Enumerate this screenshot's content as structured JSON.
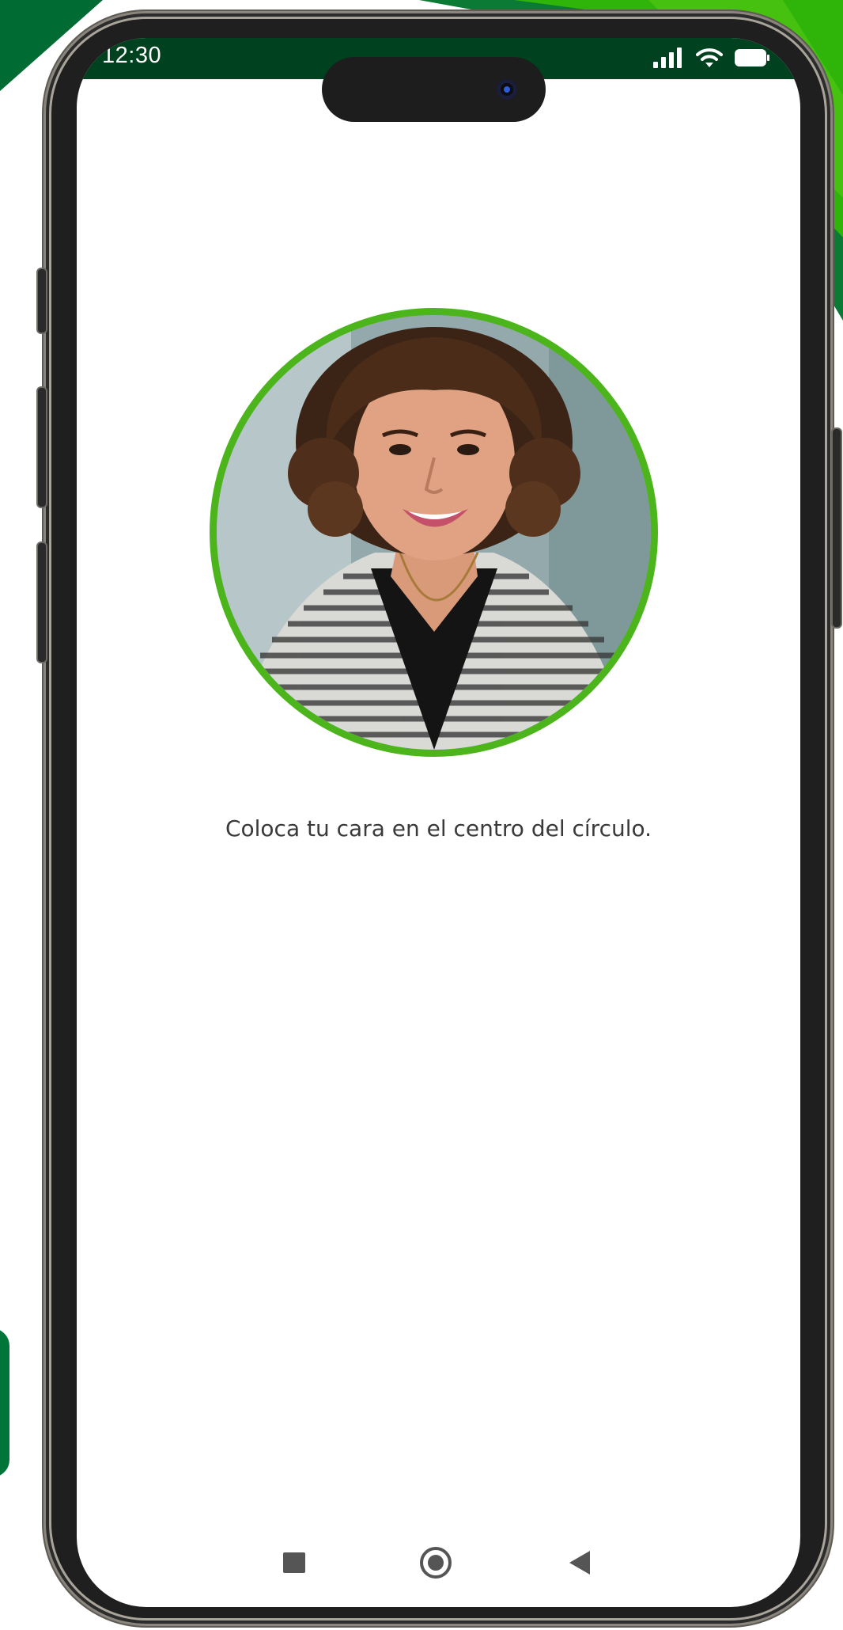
{
  "status_bar": {
    "time": "12:30",
    "icons": [
      "cellular-signal-icon",
      "wifi-icon",
      "battery-icon"
    ]
  },
  "main": {
    "instruction": "Coloca tu cara en el centro del círculo."
  },
  "nav_bar": {
    "buttons": [
      "recents-square-icon",
      "home-circle-icon",
      "back-triangle-icon"
    ]
  },
  "colors": {
    "accent_green": "#4cb51c",
    "status_bar_green": "#00421f",
    "brand_dark_green": "#006b32",
    "brand_light_green": "#3cc20a",
    "nav_icon_gray": "#555555"
  }
}
